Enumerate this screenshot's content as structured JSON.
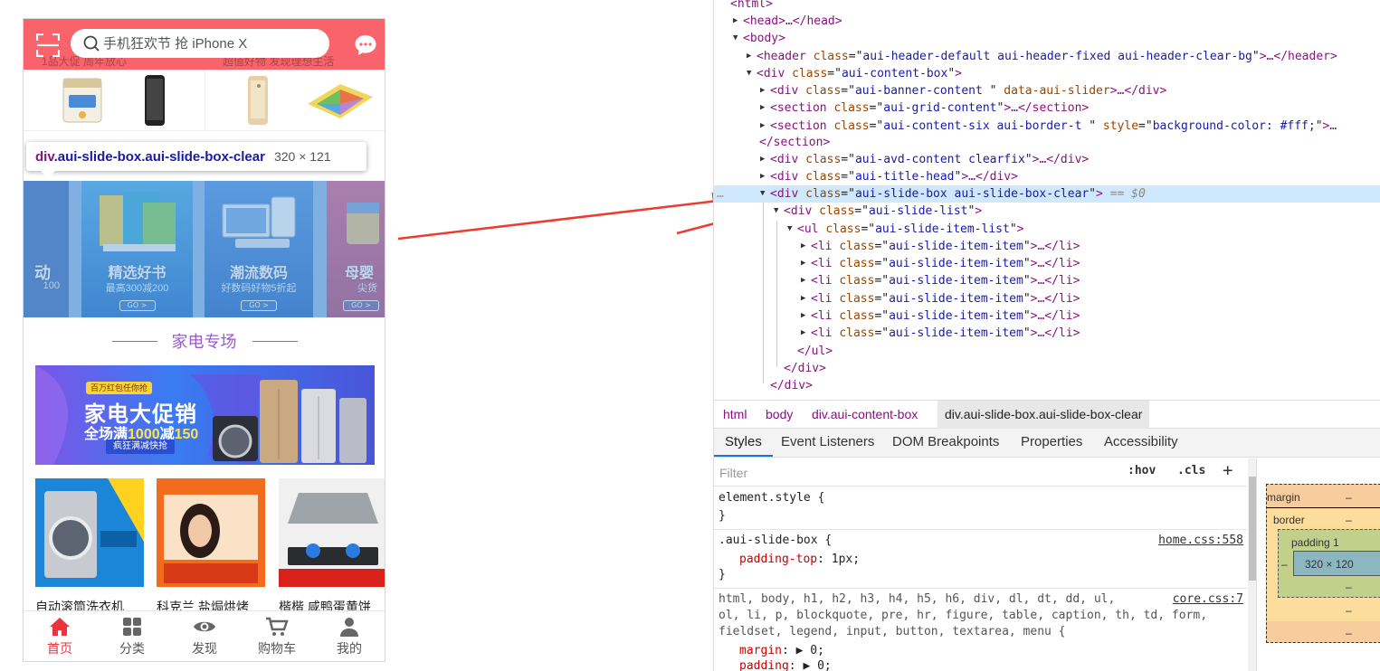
{
  "phone": {
    "search_placeholder": "手机狂欢节 抢 iPhone X",
    "header_ghost_left": "1品大促 周年放心",
    "header_ghost_right": "超值好物 发现理想生活",
    "tooltip": {
      "tag": "div",
      "classes": ".aui-slide-box.aui-slide-box-clear",
      "size": "320 × 121"
    },
    "slides": [
      {
        "title": "动",
        "sub": "100"
      },
      {
        "title": "精选好书",
        "sub": "最高300减200",
        "go": "GO >"
      },
      {
        "title": "潮流数码",
        "sub": "好数码好物5折起",
        "go": "GO >"
      },
      {
        "title": "母婴",
        "sub": "尖货",
        "go": "GO >"
      }
    ],
    "section_title": "家电专场",
    "banner": {
      "tag": "百万红包任你抢",
      "headline": "家电大促销",
      "subline_pre": "全场满",
      "subline_hl": "1000",
      "subline_mid": "减",
      "subline_hl2": "150",
      "button": "疯狂满减快抢"
    },
    "products": [
      {
        "name": "自动滚筒洗衣机"
      },
      {
        "name": "科克兰 盐焗烘烤"
      },
      {
        "name": "楷楷 咸鸭蛋黄饼"
      }
    ],
    "tabbar": [
      {
        "label": "首页",
        "icon": "home-icon",
        "active": true
      },
      {
        "label": "分类",
        "icon": "grid-icon"
      },
      {
        "label": "发现",
        "icon": "eye-icon"
      },
      {
        "label": "购物车",
        "icon": "cart-icon"
      },
      {
        "label": "我的",
        "icon": "user-icon"
      }
    ],
    "colors": {
      "header": "#f9636b",
      "accent": "#e9333e",
      "section": "#9b59d0"
    }
  },
  "devtools": {
    "dom_lines": [
      {
        "text": "<html>"
      },
      {
        "text": "<head>…</head>"
      },
      {
        "text": "<body>"
      },
      {
        "open": "<header ",
        "attr": "class",
        "val": "aui-header-default aui-header-fixed aui-header-clear-bg",
        "close": ">…</header>"
      },
      {
        "open": "<div ",
        "attr": "class",
        "val": "aui-content-box",
        "close": ">"
      },
      {
        "open": "<div ",
        "attr": "class",
        "val": "aui-banner-content ",
        "extra": " data-aui-slider",
        "close": ">…</div>"
      },
      {
        "open": "<section ",
        "attr": "class",
        "val": "aui-grid-content",
        "close": ">…</section>"
      },
      {
        "open": "<section ",
        "attr": "class",
        "val": "aui-content-six aui-border-t ",
        "extra_attr": " style",
        "extra_val": "background-color: #fff;",
        "close": ">…"
      },
      {
        "text": "</section>"
      },
      {
        "open": "<div ",
        "attr": "class",
        "val": "aui-avd-content clearfix",
        "close": ">…</div>"
      },
      {
        "open": "<div ",
        "attr": "class",
        "val": "aui-title-head",
        "close": ">…</div>"
      },
      {
        "open": "<div ",
        "attr": "class",
        "val": "aui-slide-box aui-slide-box-clear",
        "close": ">",
        "eq": " == $0"
      },
      {
        "open": "<div ",
        "attr": "class",
        "val": "aui-slide-list",
        "close": ">"
      },
      {
        "open": "<ul ",
        "attr": "class",
        "val": "aui-slide-item-list",
        "close": ">"
      },
      {
        "open": "<li ",
        "attr": "class",
        "val": "aui-slide-item-item",
        "close": ">…</li>"
      },
      {
        "open": "<li ",
        "attr": "class",
        "val": "aui-slide-item-item",
        "close": ">…</li>"
      },
      {
        "open": "<li ",
        "attr": "class",
        "val": "aui-slide-item-item",
        "close": ">…</li>"
      },
      {
        "open": "<li ",
        "attr": "class",
        "val": "aui-slide-item-item",
        "close": ">…</li>"
      },
      {
        "open": "<li ",
        "attr": "class",
        "val": "aui-slide-item-item",
        "close": ">…</li>"
      },
      {
        "open": "<li ",
        "attr": "class",
        "val": "aui-slide-item-item",
        "close": ">…</li>"
      },
      {
        "text": "</ul>"
      },
      {
        "text": "</div>"
      },
      {
        "text": "</div>"
      }
    ],
    "breadcrumbs": [
      "html",
      "body",
      "div.aui-content-box",
      "div.aui-slide-box.aui-slide-box-clear"
    ],
    "tabs": [
      "Styles",
      "Event Listeners",
      "DOM Breakpoints",
      "Properties",
      "Accessibility"
    ],
    "filter_placeholder": "Filter",
    "hov": ":hov",
    "cls": ".cls",
    "plus": "+",
    "styles": {
      "element_style": "element.style {",
      "close": "}",
      "rule1_selector": ".aui-slide-box {",
      "rule1_source": "home.css:558",
      "rule1_prop": "padding-top",
      "rule1_val": ": 1px;",
      "rule2_selector_1": "html, body, h1, h2, h3, h4, h5, h6, div, dl, dt, dd, ul,",
      "rule2_selector_2": "ol, li, p, blockquote, pre, hr, figure, table, caption, th, td, form,",
      "rule2_selector_3": "fieldset, legend, input, button, textarea, menu {",
      "rule2_source": "core.css:7",
      "rule2_prop1": "margin",
      "rule2_val1": ": ▶ 0;",
      "rule2_prop2": "padding",
      "rule2_val2": ": ▶ 0;"
    },
    "boxmodel": {
      "margin": "margin",
      "border": "border",
      "padding": "padding 1",
      "content": "320 × 120",
      "dash": "–"
    }
  }
}
